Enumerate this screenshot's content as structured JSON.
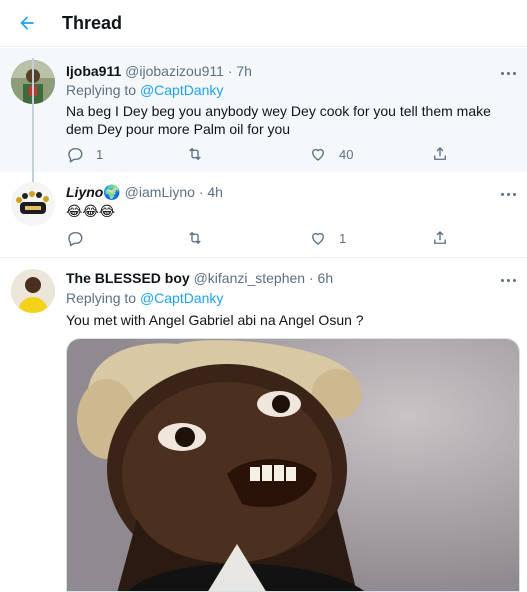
{
  "header": {
    "title": "Thread"
  },
  "tweets": [
    {
      "name": "Ijoba911",
      "handle": "@ijobazizou911",
      "time": "· 7h",
      "replying_label": "Replying to",
      "replying_to": "@CaptDanky",
      "text": "Na beg I Dey beg you  anybody wey Dey cook for you tell them make dem Dey pour more Palm oil for you",
      "reply_count": "1",
      "retweet_count": "",
      "like_count": "40"
    },
    {
      "name": "Liyno",
      "name_emoji": "🌍",
      "handle": "@iamLiyno",
      "time": "· 4h",
      "text": "😂😂😂",
      "reply_count": "",
      "retweet_count": "",
      "like_count": "1"
    },
    {
      "name": "The BLESSED boy",
      "handle": "@kifanzi_stephen",
      "time": "· 6h",
      "replying_label": "Replying to",
      "replying_to": "@CaptDanky",
      "text": "You met with Angel Gabriel abi na Angel Osun ?"
    }
  ],
  "colors": {
    "accent": "#1da1f2",
    "secondary_text": "#5b7083",
    "highlight_bg": "#f5f8fa"
  },
  "icons": [
    "back-arrow-icon",
    "more-icon",
    "reply-icon",
    "retweet-icon",
    "like-icon",
    "share-icon"
  ]
}
